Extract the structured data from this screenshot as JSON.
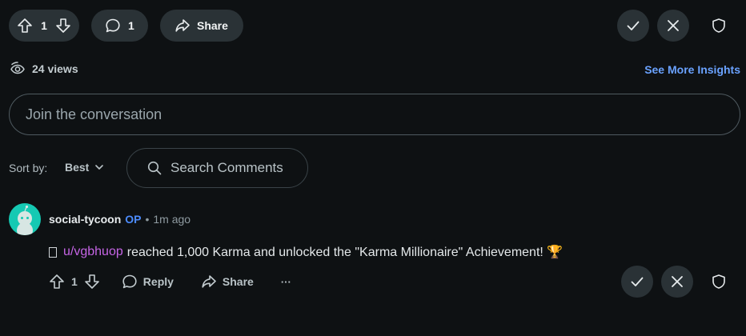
{
  "post_actions": {
    "vote_count": "1",
    "comment_count": "1",
    "share_label": "Share"
  },
  "insights": {
    "views": "24 views",
    "see_more": "See More Insights"
  },
  "composer": {
    "placeholder": "Join the conversation"
  },
  "sort": {
    "label": "Sort by:",
    "value": "Best",
    "search_placeholder": "Search Comments"
  },
  "comment": {
    "author": "social-tycoon",
    "op_badge": "OP",
    "separator": "•",
    "time": "1m ago",
    "user_link": "u/vgbhuop",
    "text": "reached 1,000 Karma and unlocked the \"Karma Millionaire\" Achievement! 🏆",
    "vote_count": "1",
    "reply_label": "Reply",
    "share_label": "Share",
    "more_label": "···"
  },
  "colors": {
    "background": "#0e1113",
    "pill": "#2a3236",
    "accent_link": "#6aa2ff",
    "op_badge": "#4c8cff",
    "user_link": "#c665e6",
    "avatar": "#15c9b3"
  }
}
